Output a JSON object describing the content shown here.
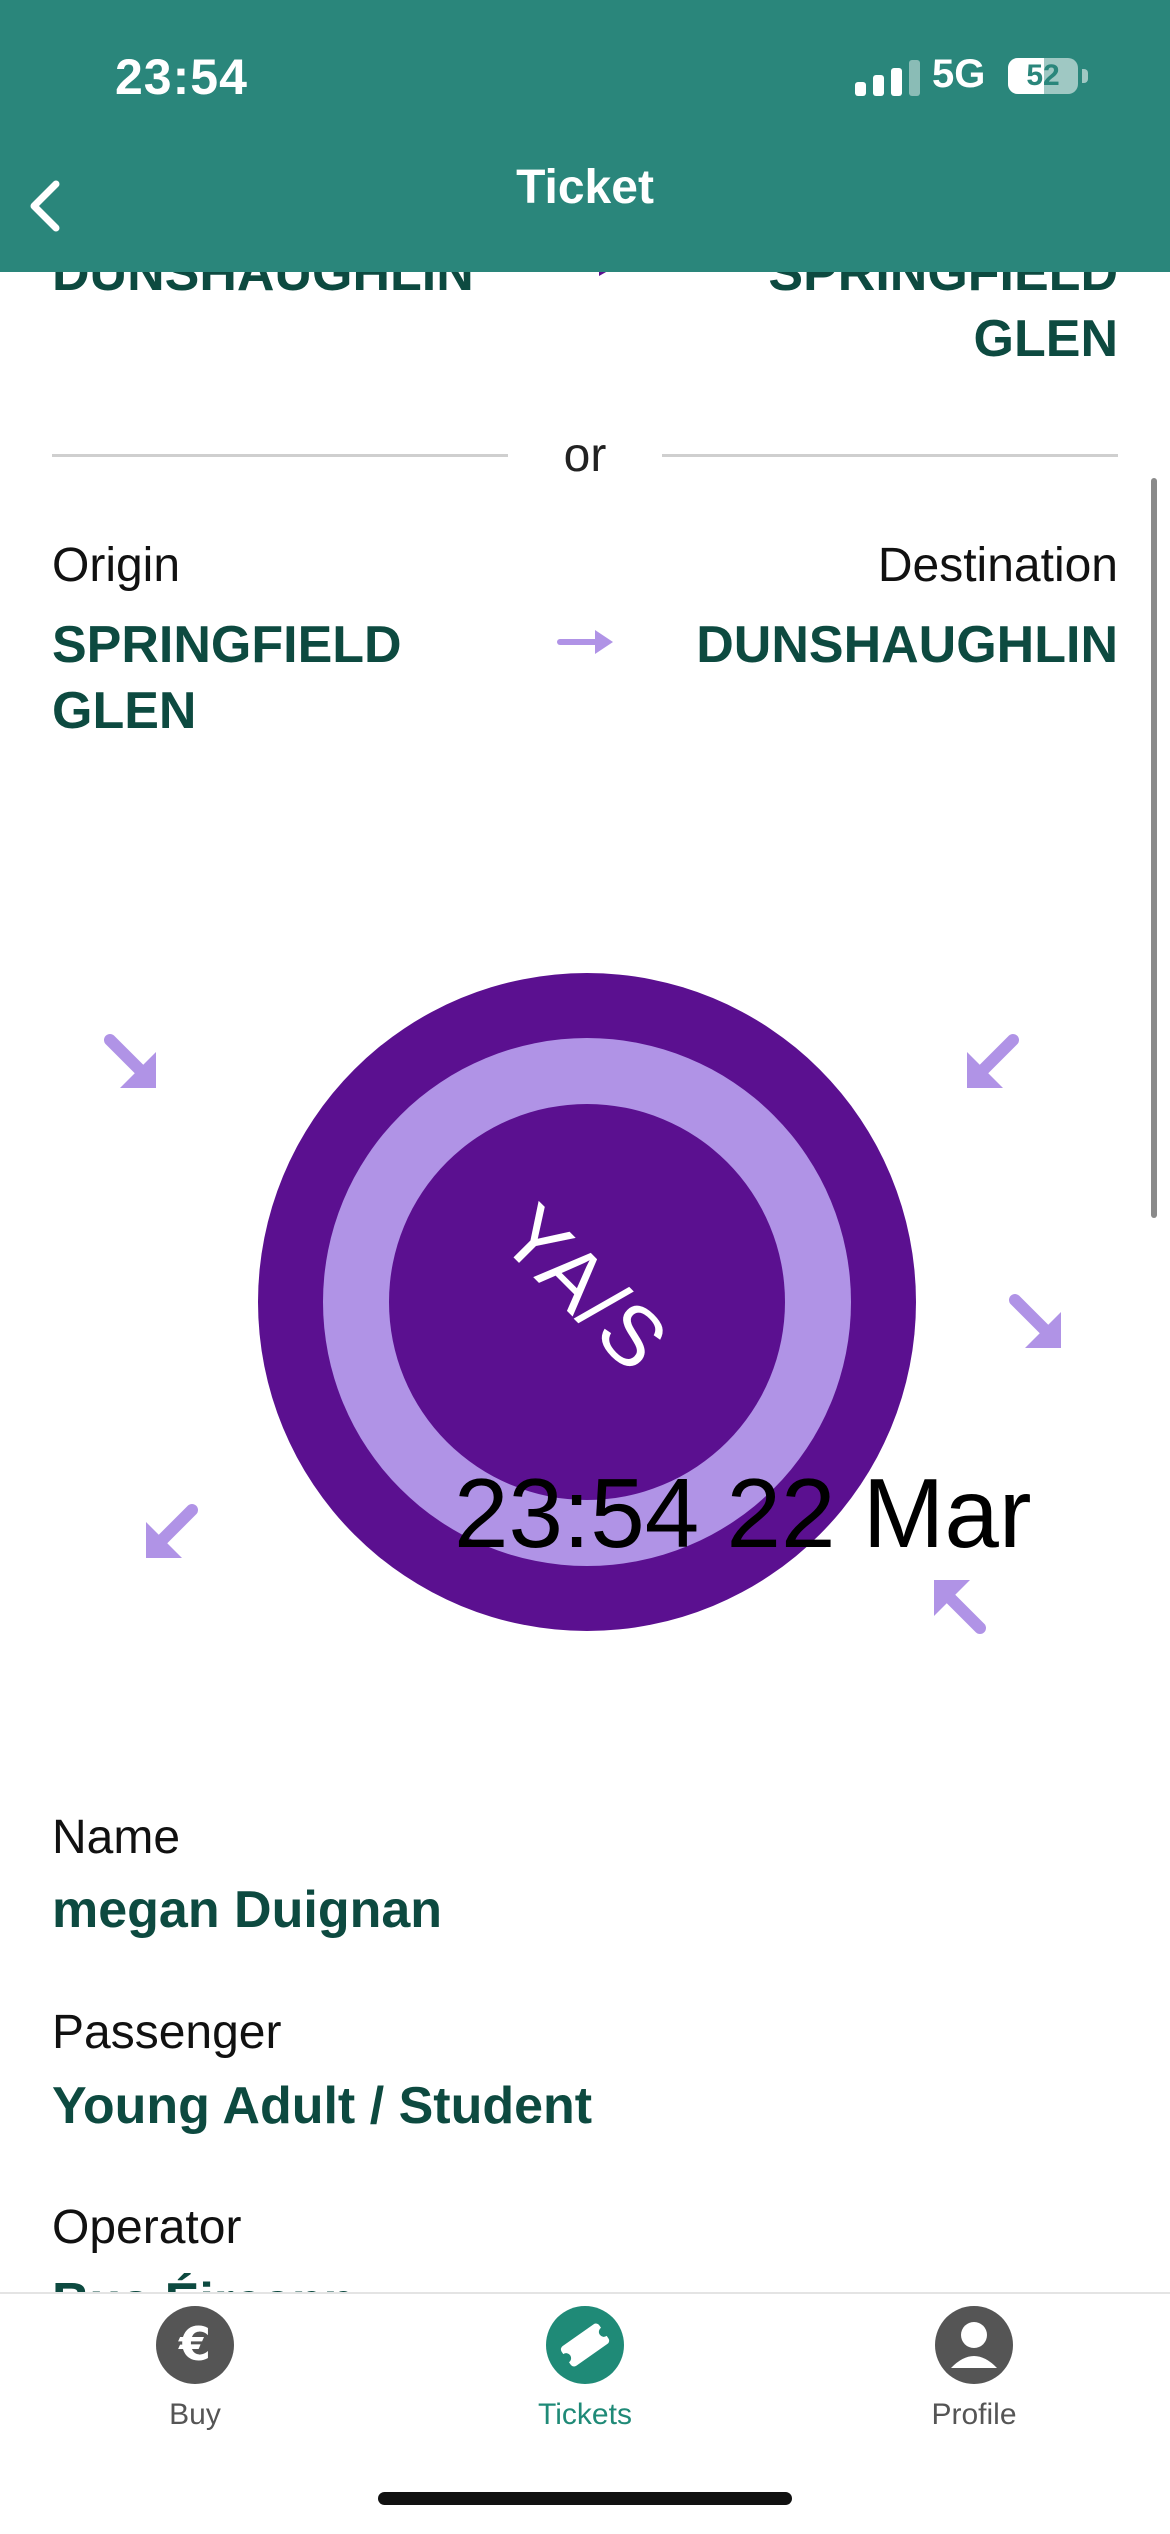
{
  "status_bar": {
    "time": "23:54",
    "network": "5G",
    "battery_level": "52",
    "battery_fraction": 0.52
  },
  "header": {
    "title": "Ticket",
    "back_icon": "chevron-left-icon"
  },
  "previous_route": {
    "origin": "DUNSHAUGHLIN",
    "destination": "SPRINGFIELD GLEN"
  },
  "divider_text": "or",
  "route": {
    "origin_label": "Origin",
    "destination_label": "Destination",
    "origin": "SPRINGFIELD GLEN",
    "destination": "DUNSHAUGHLIN",
    "arrow_icon": "arrow-right-icon"
  },
  "ticket_graphic": {
    "code": "YA/S",
    "timestamp": "23:54 22 Mar",
    "colors": {
      "disc": "#5b1090",
      "ring": "#b093e6",
      "arrows": "#b093e6"
    }
  },
  "details": {
    "name_label": "Name",
    "name_value": "megan Duignan",
    "passenger_label": "Passenger",
    "passenger_value": "Young Adult / Student",
    "operator_label": "Operator",
    "operator_value": "Bus Éireann"
  },
  "tabbar": {
    "items": [
      {
        "label": "Buy",
        "icon": "euro-icon",
        "active": false
      },
      {
        "label": "Tickets",
        "icon": "ticket-icon",
        "active": true
      },
      {
        "label": "Profile",
        "icon": "profile-icon",
        "active": false
      }
    ]
  },
  "colors": {
    "brand_header": "#2a867b",
    "text_primary": "#0d4a40",
    "tab_active": "#1f8a77",
    "tab_inactive": "#555555"
  }
}
